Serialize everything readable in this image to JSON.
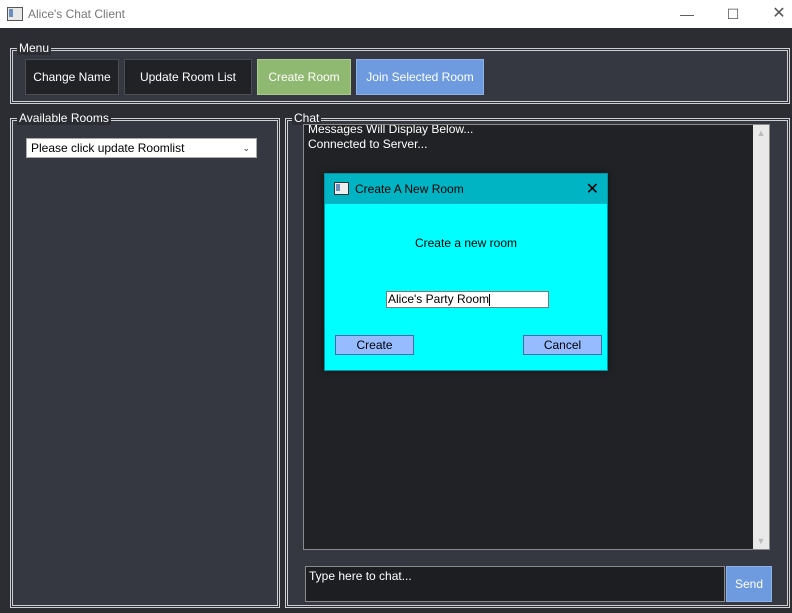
{
  "window": {
    "title": "Alice's Chat Client",
    "minimize_glyph": "—",
    "maximize_glyph": "☐",
    "close_glyph": "✕"
  },
  "menu": {
    "legend": "Menu",
    "buttons": [
      {
        "label": "Change Name"
      },
      {
        "label": "Update Room List"
      },
      {
        "label": "Create Room"
      },
      {
        "label": "Join Selected Room"
      }
    ]
  },
  "rooms": {
    "legend": "Available Rooms",
    "combo_value": "Please click update Roomlist"
  },
  "chat": {
    "legend": "Chat",
    "messages": [
      "Messages Will Display Below...",
      "Connected to Server..."
    ],
    "input_value": "Type here to chat...",
    "send_label": "Send"
  },
  "dialog": {
    "title": "Create A New Room",
    "prompt": "Create a new room",
    "input_value": "Alice's Party Room",
    "create_label": "Create",
    "cancel_label": "Cancel"
  },
  "colors": {
    "create_room_button": "#8fb870",
    "join_button": "#6e9be0",
    "dialog_bg": "#00ffff",
    "dialog_titlebar": "#00b4c4"
  }
}
